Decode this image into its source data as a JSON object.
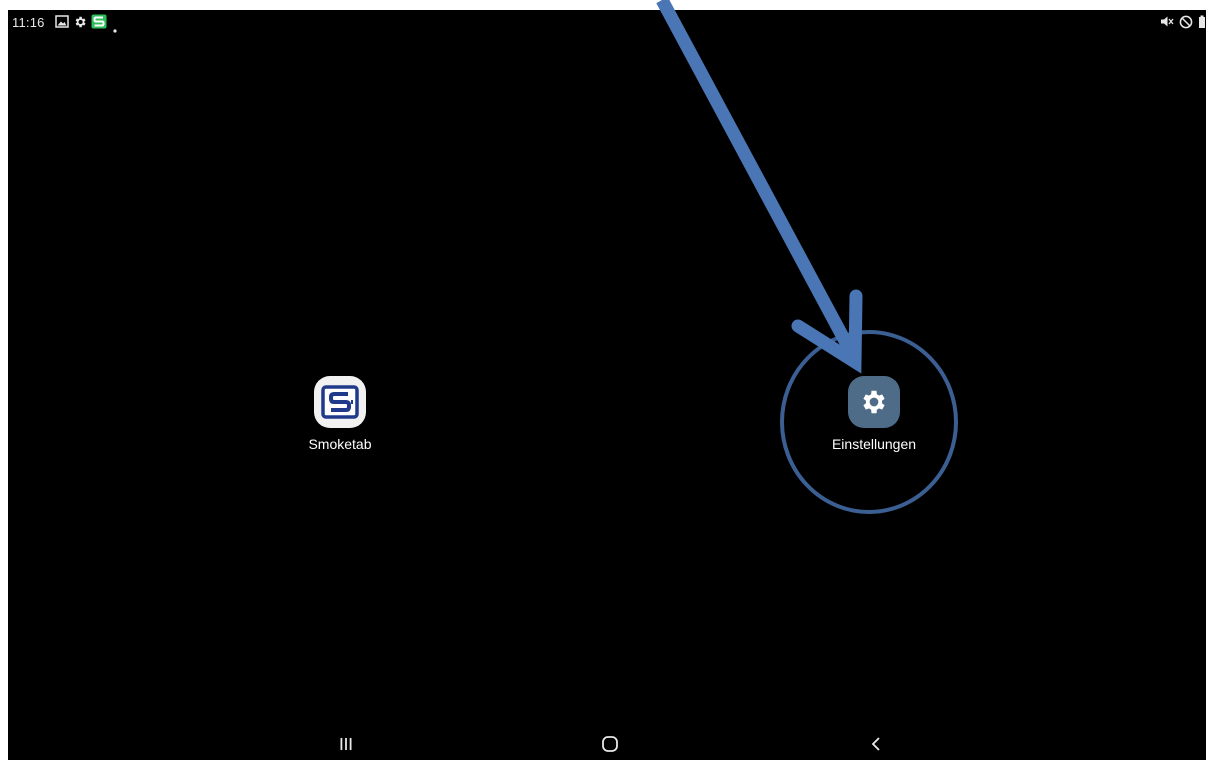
{
  "status_bar": {
    "time": "11:16",
    "left_icons": [
      "gallery-icon",
      "settings-notification-icon",
      "smoketab-notification-icon",
      "more-notifications-dot-icon"
    ],
    "right_icons": [
      "mute-icon",
      "do-not-disturb-icon",
      "battery-icon"
    ]
  },
  "home_screen": {
    "apps": [
      {
        "label": "Smoketab",
        "icon": "smoketab-app-icon",
        "tile_color": "#f1f1f1",
        "logo_color": "#1f3a8a"
      },
      {
        "label": "Einstellungen",
        "icon": "gear-icon",
        "tile_color": "#4e6c87"
      }
    ]
  },
  "navigation_bar": {
    "buttons": [
      "recents-icon",
      "home-icon",
      "back-icon"
    ]
  },
  "annotation": {
    "type": "arrow-and-circle",
    "target": "Einstellungen",
    "color": "#4a76b5",
    "circle_color": "#3c5f93"
  }
}
